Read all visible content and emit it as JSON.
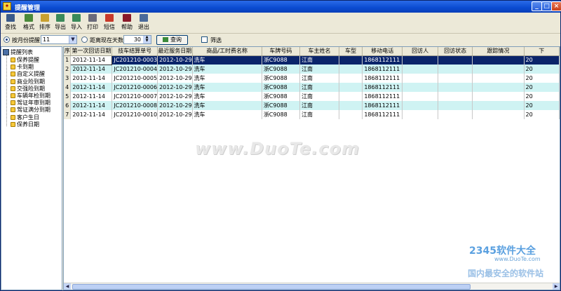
{
  "window": {
    "title": "提醒管理",
    "buttons": {
      "minimize": "_",
      "maximize": "□",
      "close": "×"
    }
  },
  "toolbar": [
    {
      "label": "查找",
      "icon": "binoculars-icon",
      "color": "#3a5a8a"
    },
    {
      "label": "格式",
      "icon": "grid-format-icon",
      "color": "#4a8a3a"
    },
    {
      "label": "排序",
      "icon": "sort-icon",
      "color": "#c8a030"
    },
    {
      "label": "导出",
      "icon": "export-icon",
      "color": "#3a8a5a"
    },
    {
      "label": "导入",
      "icon": "import-icon",
      "color": "#3a8a5a"
    },
    {
      "label": "打印",
      "icon": "printer-icon",
      "color": "#6a6a7a"
    },
    {
      "label": "短信",
      "icon": "sms-icon",
      "color": "#c83a2a"
    },
    {
      "label": "帮助",
      "icon": "help-book-icon",
      "color": "#8a1a2a"
    },
    {
      "label": "退出",
      "icon": "exit-icon",
      "color": "#4a6a9a"
    }
  ],
  "filter": {
    "by_month_label": "按月份提醒",
    "month_value": "11",
    "by_days_label": "距离现在天数",
    "days_value": "30",
    "query_label": "查询",
    "filter_label": "筛选"
  },
  "tree": {
    "root": "提醒列表",
    "items": [
      "保养提醒",
      "卡到期",
      "自定义提醒",
      "商业险到期",
      "交强险到期",
      "车辆年检到期",
      "驾证年审到期",
      "驾证满分到期",
      "客户生日",
      "保养日期"
    ]
  },
  "table": {
    "columns": [
      "序",
      "第一次回访日期",
      "技车结算单号",
      "最近服务日期",
      "商品/工时费名称",
      "车牌号码",
      "车主姓名",
      "车型",
      "移动电话",
      "回访人",
      "回访状态",
      "跟踪情况",
      "下"
    ],
    "rows": [
      {
        "idx": "1",
        "visit": "2012-11-14",
        "order": "JC201210-0003",
        "date": "2012-10-29",
        "item": "洗车",
        "plate": "浙C9088",
        "owner": "江南",
        "model": "",
        "phone": "1868112111",
        "visitor": "",
        "status": "",
        "track": "",
        "next": "20"
      },
      {
        "idx": "2",
        "visit": "2012-11-14",
        "order": "JC201210-0004",
        "date": "2012-10-29",
        "item": "洗车",
        "plate": "浙C9088",
        "owner": "江南",
        "model": "",
        "phone": "1868112111",
        "visitor": "",
        "status": "",
        "track": "",
        "next": "20"
      },
      {
        "idx": "3",
        "visit": "2012-11-14",
        "order": "JC201210-0005",
        "date": "2012-10-29",
        "item": "洗车",
        "plate": "浙C9088",
        "owner": "江南",
        "model": "",
        "phone": "1868112111",
        "visitor": "",
        "status": "",
        "track": "",
        "next": "20"
      },
      {
        "idx": "4",
        "visit": "2012-11-14",
        "order": "JC201210-0006",
        "date": "2012-10-29",
        "item": "洗车",
        "plate": "浙C9088",
        "owner": "江南",
        "model": "",
        "phone": "1868112111",
        "visitor": "",
        "status": "",
        "track": "",
        "next": "20"
      },
      {
        "idx": "5",
        "visit": "2012-11-14",
        "order": "JC201210-0007",
        "date": "2012-10-29",
        "item": "洗车",
        "plate": "浙C9088",
        "owner": "江南",
        "model": "",
        "phone": "1868112111",
        "visitor": "",
        "status": "",
        "track": "",
        "next": "20"
      },
      {
        "idx": "6",
        "visit": "2012-11-14",
        "order": "JC201210-0008",
        "date": "2012-10-29",
        "item": "洗车",
        "plate": "浙C9088",
        "owner": "江南",
        "model": "",
        "phone": "1868112111",
        "visitor": "",
        "status": "",
        "track": "",
        "next": "20"
      },
      {
        "idx": "7",
        "visit": "2012-11-14",
        "order": "JC201210-0010",
        "date": "2012-10-29",
        "item": "洗车",
        "plate": "浙C9088",
        "owner": "江南",
        "model": "",
        "phone": "1868112111",
        "visitor": "",
        "status": "",
        "track": "",
        "next": "20"
      }
    ]
  },
  "watermark": {
    "main": "www.DuoTe.com",
    "brand": "2345软件大全",
    "url": "www.DuoTe.com",
    "slogan": "国内最安全的软件站"
  }
}
